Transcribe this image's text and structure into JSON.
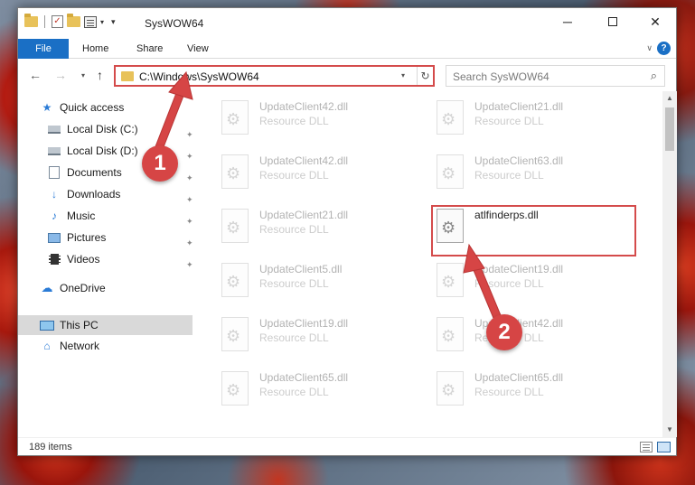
{
  "window": {
    "title": "SysWOW64",
    "minimize": "─",
    "close": "✕"
  },
  "ribbon": {
    "tabs": [
      "File",
      "Home",
      "Share",
      "View"
    ]
  },
  "address": {
    "path": "C:\\Windows\\SysWOW64",
    "refresh": "↻"
  },
  "search": {
    "placeholder": "Search SysWOW64"
  },
  "sidebar": {
    "items": [
      {
        "label": "Quick access",
        "icon": "star-icon"
      },
      {
        "label": "Local Disk (C:)",
        "icon": "drive-icon"
      },
      {
        "label": "Local Disk (D:)",
        "icon": "drive-icon"
      },
      {
        "label": "Documents",
        "icon": "documents-icon"
      },
      {
        "label": "Downloads",
        "icon": "downloads-icon"
      },
      {
        "label": "Music",
        "icon": "music-icon"
      },
      {
        "label": "Pictures",
        "icon": "pictures-icon"
      },
      {
        "label": "Videos",
        "icon": "videos-icon"
      },
      {
        "label": "OneDrive",
        "icon": "onedrive-icon"
      },
      {
        "label": "This PC",
        "icon": "this-pc-icon"
      },
      {
        "label": "Network",
        "icon": "network-icon"
      }
    ]
  },
  "files": [
    {
      "name": "UpdateClient42.dll",
      "type": "Resource DLL"
    },
    {
      "name": "UpdateClient21.dll",
      "type": "Resource DLL"
    },
    {
      "name": "UpdateClient42.dll",
      "type": "Resource DLL"
    },
    {
      "name": "UpdateClient63.dll",
      "type": "Resource DLL"
    },
    {
      "name": "UpdateClient21.dll",
      "type": "Resource DLL"
    },
    {
      "name": "atlfinderps.dll",
      "type": ""
    },
    {
      "name": "UpdateClient5.dll",
      "type": "Resource DLL"
    },
    {
      "name": "UpdateClient19.dll",
      "type": "Resource DLL"
    },
    {
      "name": "UpdateClient19.dll",
      "type": "Resource DLL"
    },
    {
      "name": "UpdateClient42.dll",
      "type": "Resource DLL"
    },
    {
      "name": "UpdateClient65.dll",
      "type": "Resource DLL"
    },
    {
      "name": "UpdateClient65.dll",
      "type": "Resource DLL"
    }
  ],
  "status": {
    "item_count": "189 items"
  },
  "annotations": {
    "step1": "1",
    "step2": "2",
    "accent_color": "#d64545"
  }
}
